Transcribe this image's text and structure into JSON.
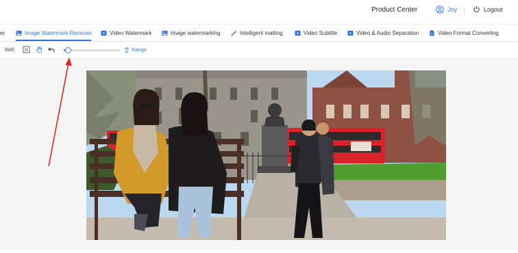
{
  "header": {
    "product_center": "Product Center",
    "user_name": "Joy",
    "logout_label": "Logout",
    "accent_color": "#2f74e6"
  },
  "tabs": [
    {
      "label": "er",
      "icon": "partial-tab"
    },
    {
      "label": "Image Watermark Remover",
      "icon": "image-icon",
      "active": true
    },
    {
      "label": "Video Watermark",
      "icon": "video-icon"
    },
    {
      "label": "Image watermarking",
      "icon": "image-icon"
    },
    {
      "label": "Intelligent matting",
      "icon": "wand-icon"
    },
    {
      "label": "Video Subtitle",
      "icon": "video-icon"
    },
    {
      "label": "Video & Audio Separation",
      "icon": "video-icon"
    },
    {
      "label": "Video Format Converting",
      "icon": "file-video-icon"
    }
  ],
  "toolbar": {
    "label": "tool:",
    "brush_size": 0.07,
    "range_label": "Range"
  }
}
